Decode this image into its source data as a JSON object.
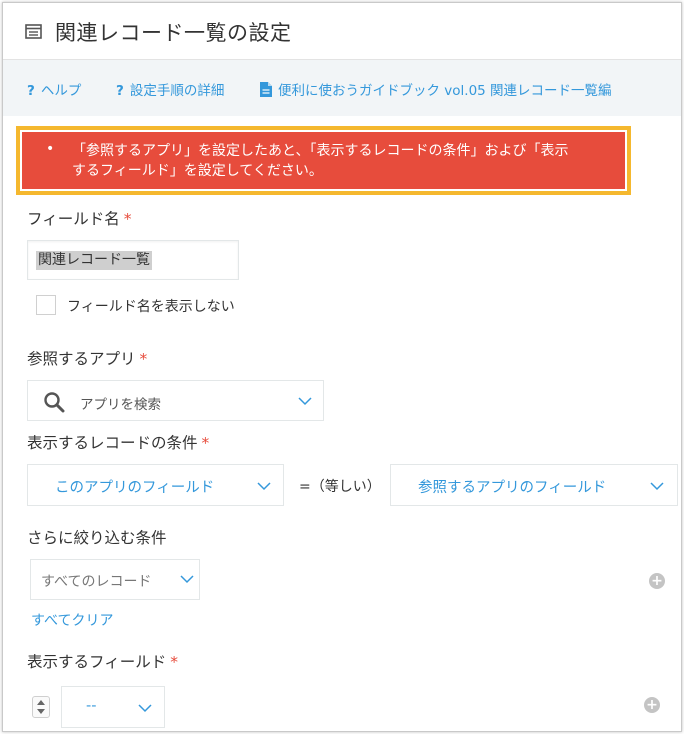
{
  "dialog": {
    "title": "関連レコード一覧の設定",
    "title_icon": "list-window-icon"
  },
  "help_links": [
    {
      "icon": "question-icon",
      "label": "ヘルプ"
    },
    {
      "icon": "question-icon",
      "label": "設定手順の詳細"
    },
    {
      "icon": "document-icon",
      "label": "便利に使おうガイドブック vol.05 関連レコード一覧編"
    }
  ],
  "alert": {
    "line1": "「参照するアプリ」を設定したあと、「表示するレコードの条件」および「表示",
    "line2": "するフィールド」を設定してください。",
    "color": "#e74c3c",
    "highlight_color": "#f5b82e"
  },
  "field_name": {
    "label": "フィールド名",
    "required_mark": "*",
    "value": "関連レコード一覧",
    "hide_checkbox_label": "フィールド名を表示しない",
    "hide_checked": false
  },
  "reference_app": {
    "label": "参照するアプリ",
    "required_mark": "*",
    "search_placeholder": "アプリを検索"
  },
  "record_condition": {
    "label": "表示するレコードの条件",
    "required_mark": "*",
    "left_field": "このアプリのフィールド",
    "operator": "=（等しい）",
    "right_field": "参照するアプリのフィールド"
  },
  "filter": {
    "label": "さらに絞り込む条件",
    "selected": "すべてのレコード",
    "clear_label": "すべてクリア"
  },
  "display_fields": {
    "label": "表示するフィールド",
    "required_mark": "*",
    "selected": "--"
  },
  "colors": {
    "accent": "#3498db",
    "required": "#e74c3c",
    "link_bar_bg": "#f2f5f7"
  }
}
